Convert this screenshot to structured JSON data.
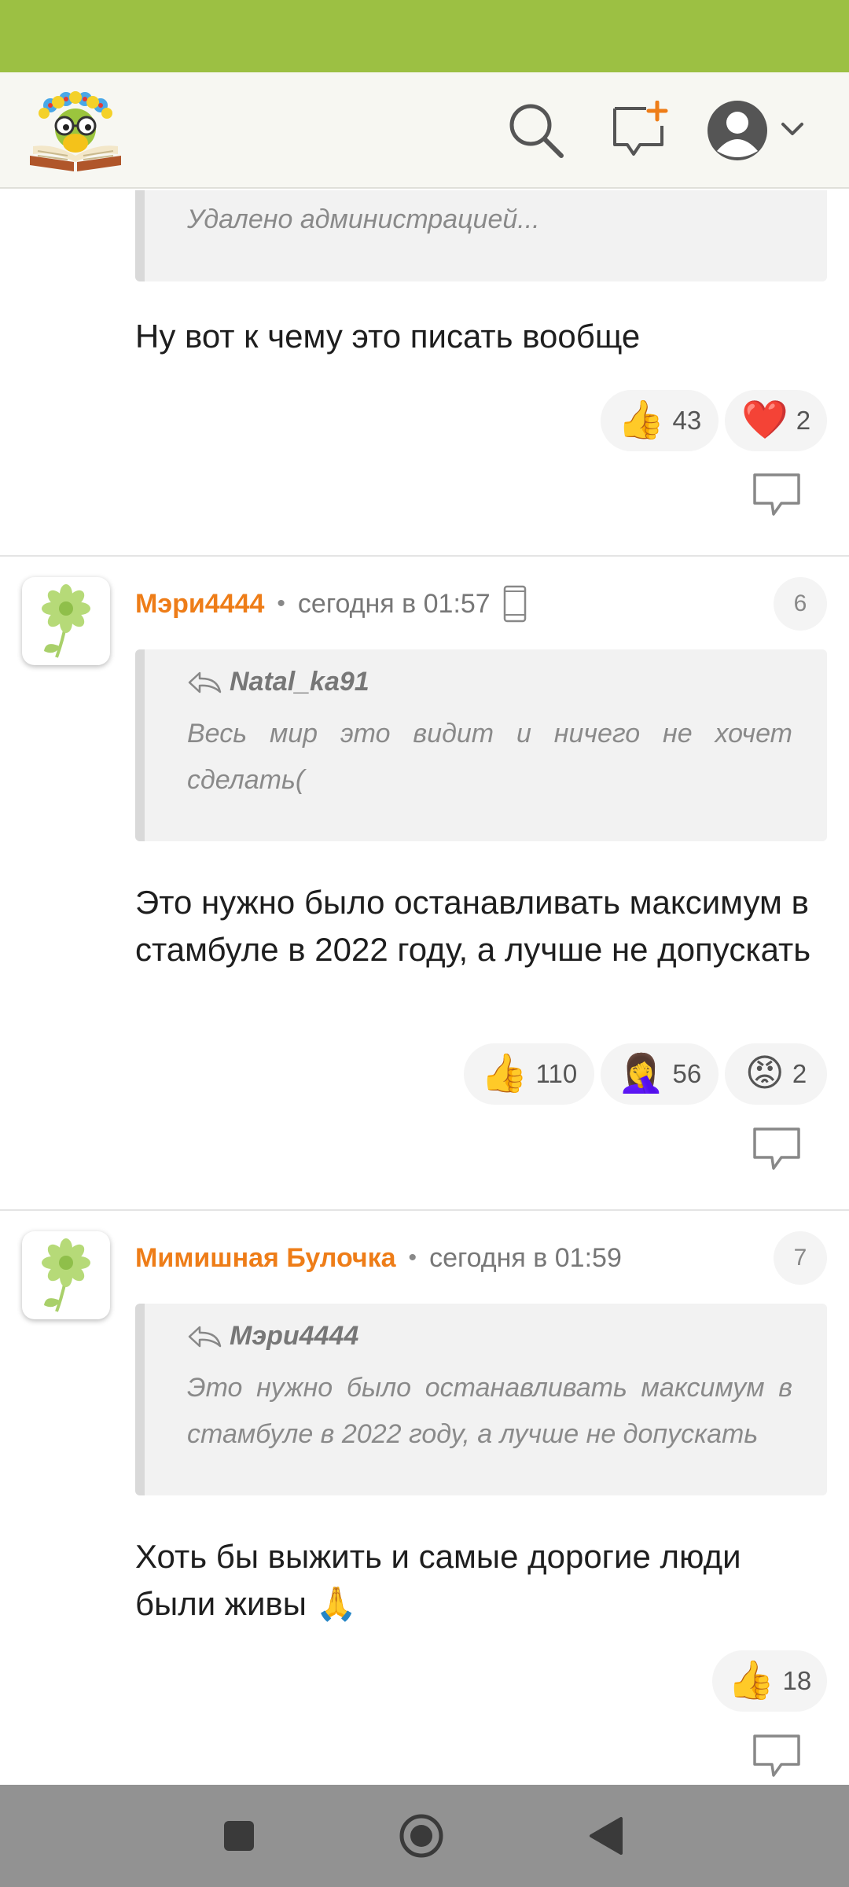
{
  "comments": [
    {
      "quote_text": "Удалено администрацией...",
      "body": "Ну вот к чему это писать вообще",
      "reactions": [
        {
          "icon": "thumbs-up-icon",
          "emoji": "👍",
          "count": "43"
        },
        {
          "icon": "heart-icon",
          "emoji": "❤️",
          "count": "2"
        }
      ]
    },
    {
      "author": "Мэри4444",
      "time": "сегодня в 01:57",
      "number": "6",
      "quote_author": "Natal_ka91",
      "quote_text": "Весь мир это видит и ничего не хочет сделать(",
      "body": "Это нужно было останавливать максимум в стамбуле в 2022 году, а лучше не допускать",
      "reactions": [
        {
          "icon": "thumbs-up-icon",
          "emoji": "👍",
          "count": "110"
        },
        {
          "icon": "facepalm-icon",
          "emoji": "🤦‍♀️",
          "count": "56"
        },
        {
          "icon": "angry-face-icon",
          "emoji": "😡",
          "count": "2"
        }
      ]
    },
    {
      "author": "Мимишная Булочка",
      "time": "сегодня в 01:59",
      "number": "7",
      "quote_author": "Мэри4444",
      "quote_text": "Это нужно было останавливать максимум в стамбуле в 2022 году, а лучше не допускать",
      "body": "Хоть бы выжить и самые дорогие люди были живы 🙏",
      "reactions": [
        {
          "icon": "thumbs-up-icon",
          "emoji": "👍",
          "count": "18"
        }
      ]
    }
  ],
  "separator": "•",
  "colors": {
    "status_bar": "#9cc043",
    "header_bg": "#f7f7f2",
    "author": "#ee7d18",
    "nav_bar": "#929292"
  }
}
